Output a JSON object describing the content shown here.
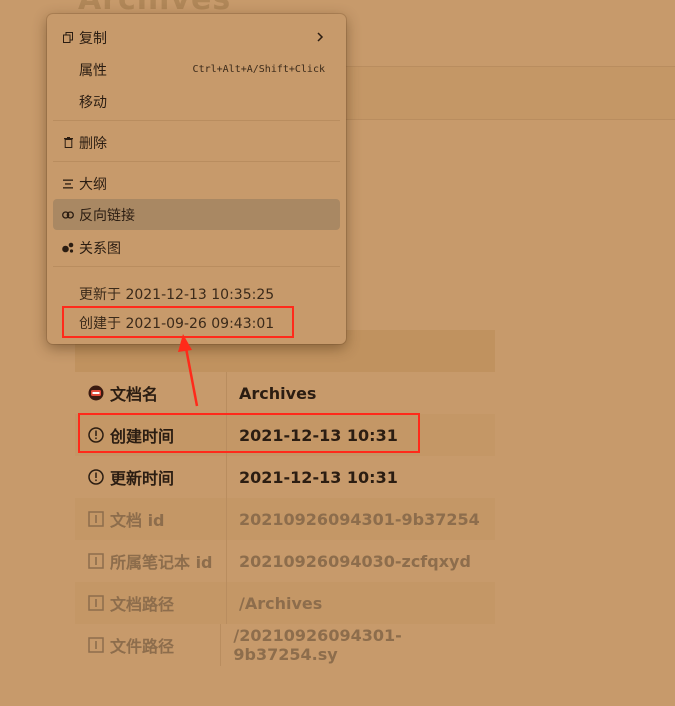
{
  "doc_title": "Archives",
  "menu": {
    "items": [
      {
        "icon": "copy-icon",
        "label": "复制"
      },
      {
        "icon": "",
        "label": "属性",
        "shortcut": "Ctrl+Alt+A/Shift+Click"
      },
      {
        "icon": "",
        "label": "移动"
      },
      {
        "icon": "trash-icon",
        "label": "删除"
      },
      {
        "icon": "outline-icon",
        "label": "大纲"
      },
      {
        "icon": "link-icon",
        "label": "反向链接"
      },
      {
        "icon": "graph-icon",
        "label": "关系图"
      }
    ],
    "updated": "更新于 2021-12-13 10:35:25",
    "created": "创建于 2021-09-26 09:43:01"
  },
  "attributes": [
    {
      "icon": "title-icon",
      "key": "文档名",
      "value": "Archives"
    },
    {
      "icon": "clock-icon",
      "key": "创建时间",
      "value": "2021-12-13 10:31"
    },
    {
      "icon": "clock-icon",
      "key": "更新时间",
      "value": "2021-12-13 10:31"
    },
    {
      "icon": "info-icon",
      "key": "文档 id",
      "value": "20210926094301-9b37254"
    },
    {
      "icon": "info-icon",
      "key": "所属笔记本 id",
      "value": "20210926094030-zcfqxyd"
    },
    {
      "icon": "info-icon",
      "key": "文档路径",
      "value": "/Archives"
    },
    {
      "icon": "info-icon",
      "key": "文件路径",
      "value": "/20210926094301-9b37254.sy"
    }
  ],
  "colors": {
    "accent_red": "#ff2a1a",
    "background": "#c79a6b",
    "menu_active": "#a98863"
  }
}
